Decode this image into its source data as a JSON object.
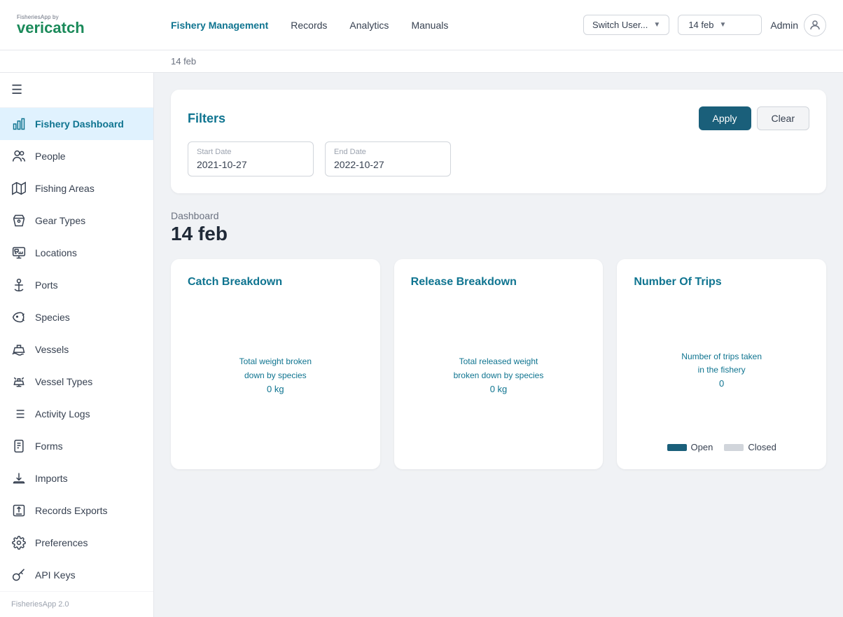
{
  "app": {
    "logo_small": "FisheriesApp by",
    "logo_main": "veri",
    "logo_accent": "catch",
    "version": "FisheriesApp 2.0"
  },
  "top_nav": {
    "links": [
      {
        "label": "Fishery Management",
        "active": true
      },
      {
        "label": "Records",
        "active": false
      },
      {
        "label": "Analytics",
        "active": false
      },
      {
        "label": "Manuals",
        "active": false
      }
    ],
    "switch_user_label": "Switch User...",
    "date_selector": "14 feb",
    "admin_label": "Admin"
  },
  "sub_nav": {
    "breadcrumb": "14 feb"
  },
  "sidebar": {
    "items": [
      {
        "id": "fishery-dashboard",
        "label": "Fishery Dashboard",
        "active": true,
        "icon": "chart"
      },
      {
        "id": "people",
        "label": "People",
        "active": false,
        "icon": "people"
      },
      {
        "id": "fishing-areas",
        "label": "Fishing Areas",
        "active": false,
        "icon": "map"
      },
      {
        "id": "gear-types",
        "label": "Gear Types",
        "active": false,
        "icon": "gear"
      },
      {
        "id": "locations",
        "label": "Locations",
        "active": false,
        "icon": "location"
      },
      {
        "id": "ports",
        "label": "Ports",
        "active": false,
        "icon": "anchor"
      },
      {
        "id": "species",
        "label": "Species",
        "active": false,
        "icon": "fish"
      },
      {
        "id": "vessels",
        "label": "Vessels",
        "active": false,
        "icon": "vessel"
      },
      {
        "id": "vessel-types",
        "label": "Vessel Types",
        "active": false,
        "icon": "vessel-type"
      },
      {
        "id": "activity-logs",
        "label": "Activity Logs",
        "active": false,
        "icon": "list"
      },
      {
        "id": "forms",
        "label": "Forms",
        "active": false,
        "icon": "form"
      },
      {
        "id": "imports",
        "label": "Imports",
        "active": false,
        "icon": "import"
      },
      {
        "id": "records-exports",
        "label": "Records Exports",
        "active": false,
        "icon": "export"
      },
      {
        "id": "preferences",
        "label": "Preferences",
        "active": false,
        "icon": "settings"
      },
      {
        "id": "api-keys",
        "label": "API Keys",
        "active": false,
        "icon": "key"
      }
    ]
  },
  "filters": {
    "title": "Filters",
    "apply_label": "Apply",
    "clear_label": "Clear",
    "start_date_label": "Start Date",
    "start_date_value": "2021-10-27",
    "end_date_label": "End Date",
    "end_date_value": "2022-10-27"
  },
  "dashboard": {
    "label": "Dashboard",
    "date": "14 feb",
    "cards": [
      {
        "id": "catch-breakdown",
        "title": "Catch Breakdown",
        "stat_line1": "Total weight broken",
        "stat_line2": "down by species",
        "stat_value": "0 kg"
      },
      {
        "id": "release-breakdown",
        "title": "Release Breakdown",
        "stat_line1": "Total released weight",
        "stat_line2": "broken down by species",
        "stat_value": "0 kg"
      },
      {
        "id": "number-of-trips",
        "title": "Number Of Trips",
        "stat_line1": "Number of trips taken",
        "stat_line2": "in the fishery",
        "stat_value": "0",
        "legend": [
          {
            "label": "Open",
            "type": "open"
          },
          {
            "label": "Closed",
            "type": "closed"
          }
        ]
      }
    ]
  }
}
